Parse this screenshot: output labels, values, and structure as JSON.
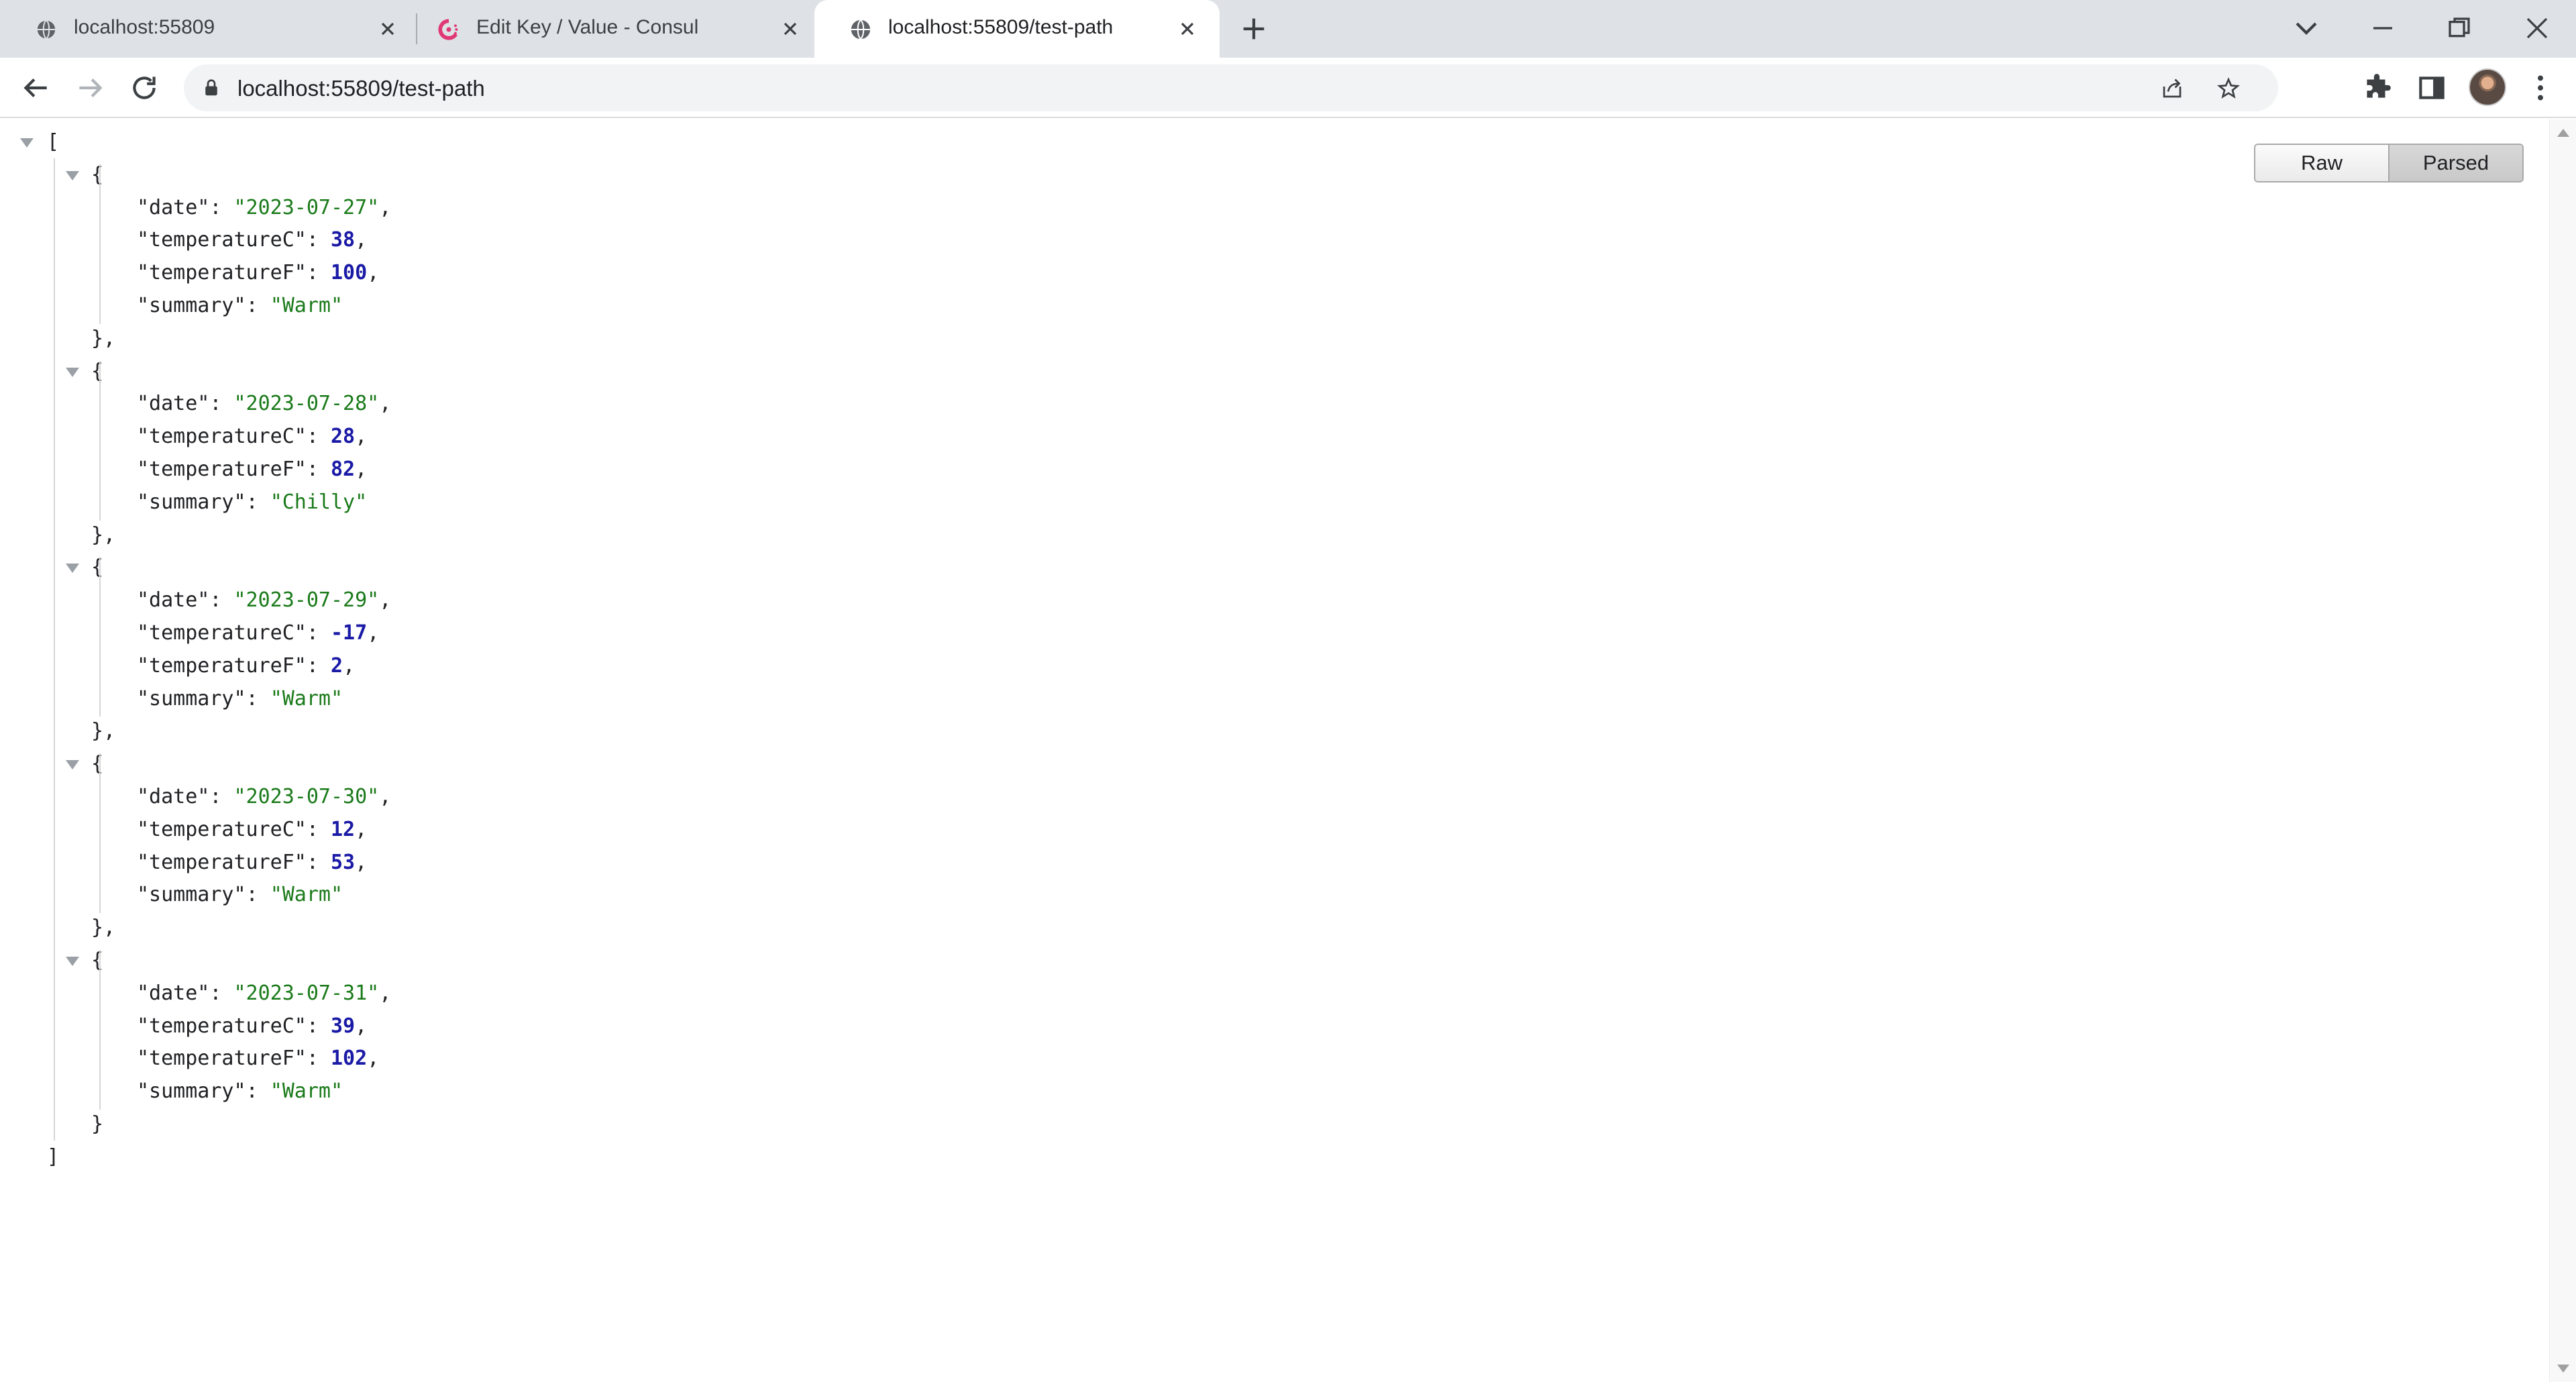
{
  "tabs": [
    {
      "title": "localhost:55809",
      "icon": "globe-icon",
      "active": false
    },
    {
      "title": "Edit Key / Value - Consul",
      "icon": "consul-icon",
      "active": false
    },
    {
      "title": "localhost:55809/test-path",
      "icon": "globe-icon",
      "active": true
    }
  ],
  "address_bar": {
    "url": "localhost:55809/test-path"
  },
  "view_toggle": {
    "raw_label": "Raw",
    "parsed_label": "Parsed",
    "selected": "Parsed"
  },
  "json": {
    "open_bracket": "[",
    "close_bracket": "]",
    "records": [
      {
        "date": "2023-07-27",
        "temperatureC": 38,
        "temperatureF": 100,
        "summary": "Warm"
      },
      {
        "date": "2023-07-28",
        "temperatureC": 28,
        "temperatureF": 82,
        "summary": "Chilly"
      },
      {
        "date": "2023-07-29",
        "temperatureC": -17,
        "temperatureF": 2,
        "summary": "Warm"
      },
      {
        "date": "2023-07-30",
        "temperatureC": 12,
        "temperatureF": 53,
        "summary": "Warm"
      },
      {
        "date": "2023-07-31",
        "temperatureC": 39,
        "temperatureF": 102,
        "summary": "Warm"
      }
    ]
  },
  "colors": {
    "tabstrip": "#dee1e6",
    "json_string": "#1a7a1a",
    "json_number": "#1a1aa6"
  }
}
